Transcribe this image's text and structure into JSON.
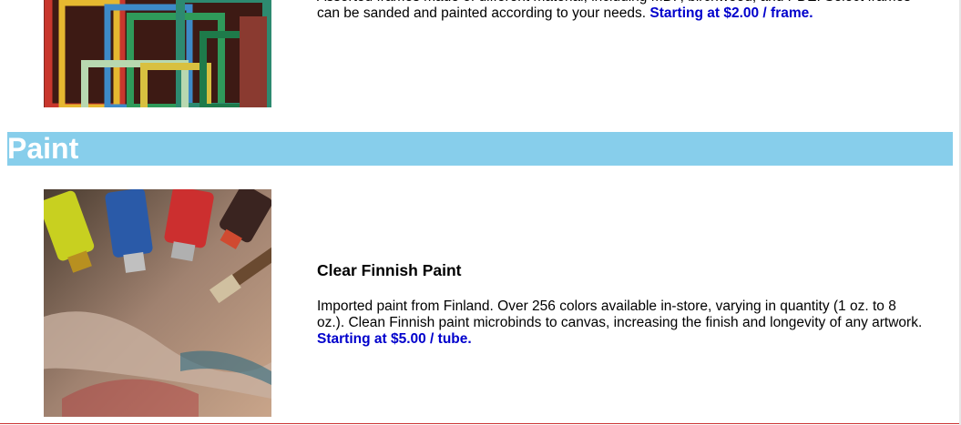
{
  "frames": {
    "description": "Assorted frames made of different material, including MDF, birchwood, and PDE. Select frames can be sanded and painted according to your needs.",
    "price": "Starting at $2.00 / frame.",
    "image_alt": "colorful-picture-frames-image"
  },
  "paint_section": {
    "heading": "Paint",
    "product": {
      "title": "Clear Finnish Paint",
      "description": "Imported paint from Finland. Over 256 colors available in-store, varying in quantity (1 oz. to 8 oz.). Clean Finnish paint microbinds to canvas, increasing the finish and longevity of any artwork.",
      "price": "Starting at $5.00 / tube.",
      "image_alt": "paint-tubes-and-palette-image"
    }
  },
  "colors": {
    "header_bg": "#87ceeb",
    "header_text": "#ffffff",
    "price": "#0000cc"
  }
}
